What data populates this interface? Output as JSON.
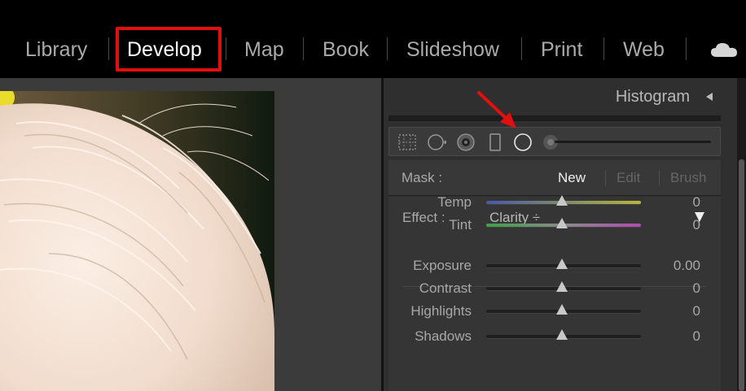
{
  "modules": {
    "library": "Library",
    "develop": "Develop",
    "map": "Map",
    "book": "Book",
    "slideshow": "Slideshow",
    "print": "Print",
    "web": "Web",
    "cloud_icon": "cloud-icon"
  },
  "panel": {
    "histogram_title": "Histogram",
    "tools": [
      "crop-overlay-icon",
      "spot-removal-icon",
      "red-eye-icon",
      "graduated-filter-icon",
      "radial-filter-icon",
      "adjustment-brush-icon"
    ],
    "mask": {
      "label": "Mask :",
      "new": "New",
      "edit": "Edit",
      "brush": "Brush"
    },
    "effect": {
      "label": "Effect :",
      "selected": "Clarity ÷"
    },
    "sliders": {
      "temp": {
        "label": "Temp",
        "value": "0"
      },
      "tint": {
        "label": "Tint",
        "value": "0"
      },
      "exposure": {
        "label": "Exposure",
        "value": "0.00"
      },
      "contrast": {
        "label": "Contrast",
        "value": "0"
      },
      "highlights": {
        "label": "Highlights",
        "value": "0"
      },
      "shadows": {
        "label": "Shadows",
        "value": "0"
      }
    }
  },
  "colors": {
    "highlight_box": "#e01010",
    "annotation_arrow": "#e01010",
    "panel_bg": "#2f2f2f"
  }
}
